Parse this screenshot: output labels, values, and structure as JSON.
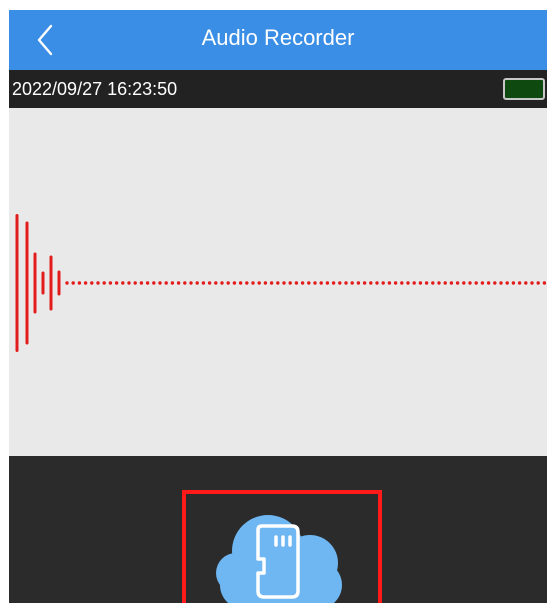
{
  "header": {
    "title": "Audio Recorder",
    "back_icon": "chevron-left-icon",
    "background_color": "#3a8ee6"
  },
  "status": {
    "timestamp": "2022/09/27 16:23:50",
    "battery_icon": "battery-icon",
    "battery_color": "#0e4a10"
  },
  "waveform": {
    "color": "#e21b1b",
    "background_color": "#e9e9e9"
  },
  "control_panel": {
    "storage_button_icon": "cloud-sd-card-icon",
    "highlight_color": "#ff1a1a",
    "cloud_color": "#6fb7f2"
  }
}
